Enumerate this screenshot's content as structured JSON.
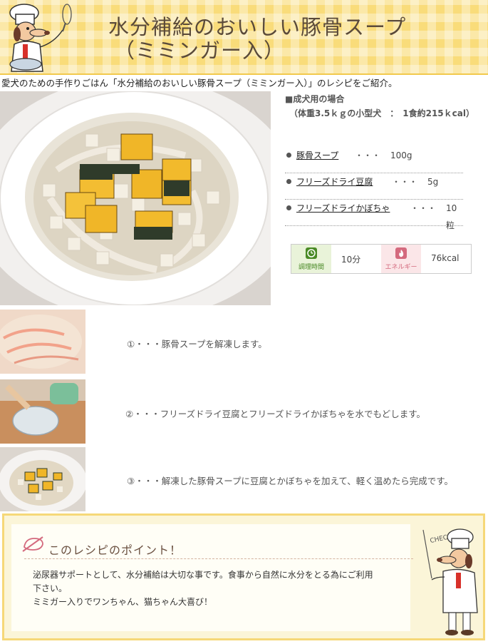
{
  "header": {
    "title_line1": "水分補給のおいしい豚骨スープ",
    "title_line2": "（ミミンガー入）"
  },
  "intro": "愛犬のための手作りごはん「水分補給のおいしい豚骨スープ（ミミンガー入）」のレシピをご紹介。",
  "recipe_info": {
    "case_label": "■成犬用の場合",
    "condition": "（体重3.5ｋｇの小型犬　：　1食約215ｋcal）"
  },
  "ingredients": [
    {
      "name": "豚骨スープ",
      "dots": "・・・",
      "amount": "100g"
    },
    {
      "name": "フリーズドライ豆腐",
      "dots": "・・・",
      "amount": "5g"
    },
    {
      "name": "フリーズドライかぼちゃ",
      "dots": "・・・",
      "amount": "10粒"
    }
  ],
  "stats": {
    "time_label": "調理時間",
    "time_value": "10分",
    "energy_label": "エネルギー",
    "energy_value": "76kcal"
  },
  "steps": [
    {
      "text": "①・・・豚骨スープを解凍します。"
    },
    {
      "text": "②・・・フリーズドライ豆腐とフリーズドライかぼちゃを水でもどします。"
    },
    {
      "text": "③・・・解凍した豚骨スープに豆腐とかぼちゃを加えて、軽く温めたら完成です。"
    }
  ],
  "point": {
    "title": "このレシピのポイント！",
    "lines": [
      "泌尿器サポートとして、水分補給は大切な事です。食事から自然に水分をとる為にご利用",
      "下さい。",
      "ミミガー入りでワンちゃん、猫ちゃん大喜び！"
    ],
    "check_label": "CHECK"
  },
  "colors": {
    "header_bg": "#f9dc7a",
    "point_border": "#f6d878",
    "time_green": "#4a8a26",
    "energy_pink": "#d46a7e"
  }
}
